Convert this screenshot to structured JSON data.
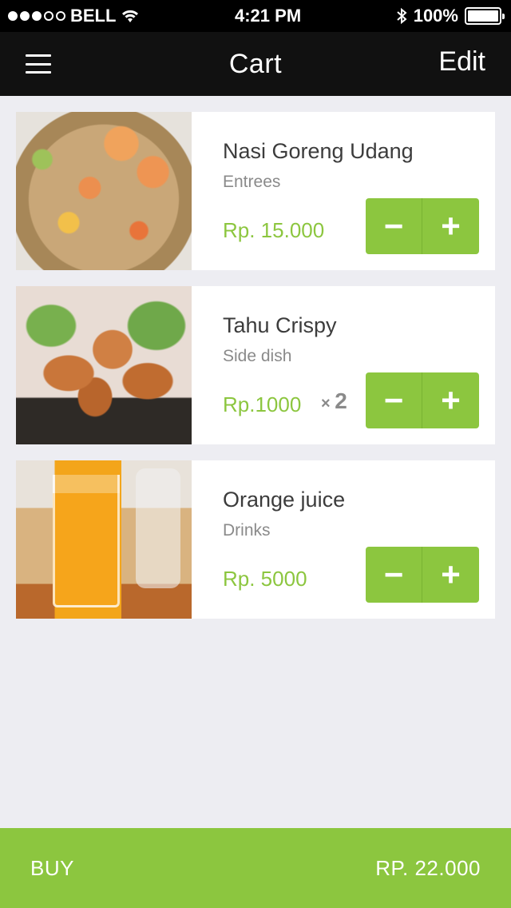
{
  "status_bar": {
    "carrier": "BELL",
    "time": "4:21 PM",
    "battery": "100%"
  },
  "nav": {
    "title": "Cart",
    "edit_label": "Edit"
  },
  "items": [
    {
      "name": "Nasi Goreng Udang",
      "category": "Entrees",
      "price": "Rp. 15.000",
      "qty": ""
    },
    {
      "name": "Tahu Crispy",
      "category": "Side dish",
      "price": "Rp.1000",
      "qty": "2"
    },
    {
      "name": "Orange juice",
      "category": "Drinks",
      "price": "Rp. 5000",
      "qty": ""
    }
  ],
  "stepper": {
    "minus": "−",
    "plus": "+"
  },
  "footer": {
    "buy_label": "BUY",
    "total": "RP. 22.000"
  },
  "colors": {
    "accent": "#8cc63f",
    "nav_bg": "#111111",
    "page_bg": "#ededf2"
  }
}
